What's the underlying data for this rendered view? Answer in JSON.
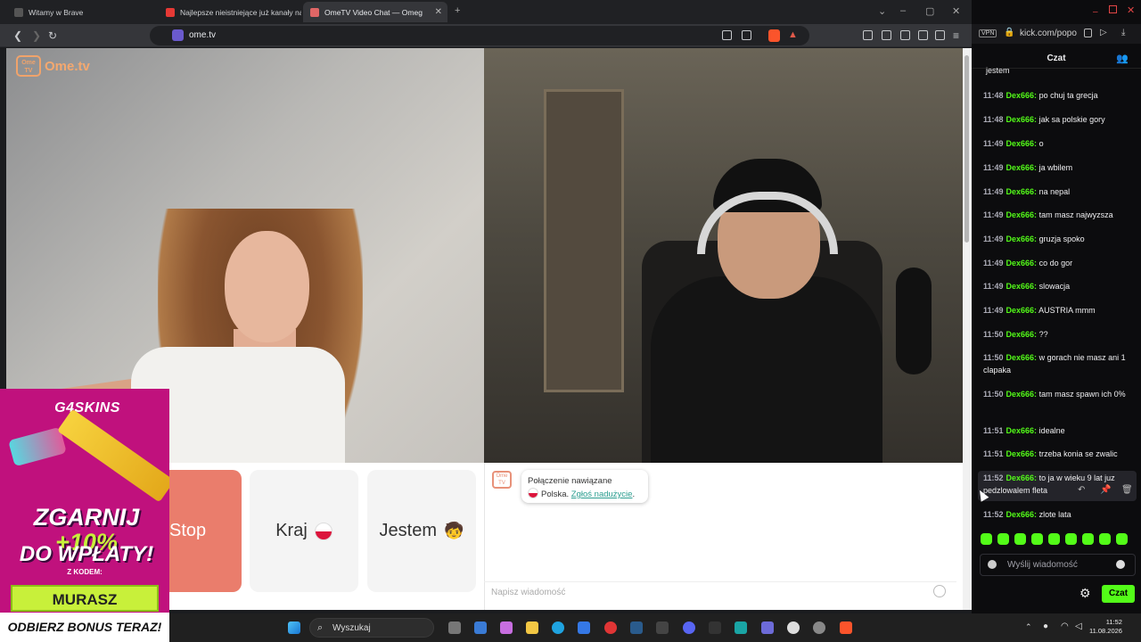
{
  "tabs": [
    {
      "title": "Witamy w Brave"
    },
    {
      "title": "Najlepsze nieistniejące już kanały na"
    },
    {
      "title": "OmeTV Video Chat — Omeg"
    }
  ],
  "address": {
    "url": "ome.tv"
  },
  "site": {
    "logo_small": "Ome TV",
    "logo_text": "Ome.tv"
  },
  "controls": {
    "stop_label": "Stop",
    "country_label": "Kraj",
    "gender_label": "Jestem",
    "gender_emoji": "🧒"
  },
  "chat": {
    "status_line": "Połączenie nawiązane",
    "country": "Polska.",
    "report_link": "Zgłoś nadużycie",
    "report_suffix": ".",
    "input_placeholder": "Napisz wiadomość",
    "icon_text": "Ome TV"
  },
  "ad": {
    "brand": "G4SKINS",
    "headline_1": "ZGARNIJ",
    "headline_bonus": "+10%",
    "headline_2": "DO WPŁATY!",
    "code_label": "Z KODEM:",
    "code": "MURASZ",
    "cta": "ODBIERZ BONUS TERAZ!"
  },
  "taskbar": {
    "search_label": "Wyszukaj",
    "time": "11:52",
    "date": "11.08.2026"
  },
  "kick": {
    "url": "kick.com/popo",
    "vpn": "VPN",
    "panel_title": "Czat",
    "send_placeholder": "Wyślij wiadomość",
    "send_button": "Czat",
    "messages": [
      {
        "time": "",
        "user": "",
        "text": "jestem"
      },
      {
        "time": "11:48",
        "user": "Dex666:",
        "text": "po chuj ta grecja"
      },
      {
        "time": "11:48",
        "user": "Dex666:",
        "text": "jak sa polskie gory"
      },
      {
        "time": "11:49",
        "user": "Dex666:",
        "text": "o"
      },
      {
        "time": "11:49",
        "user": "Dex666:",
        "text": "ja wbilem"
      },
      {
        "time": "11:49",
        "user": "Dex666:",
        "text": "na nepal"
      },
      {
        "time": "11:49",
        "user": "Dex666:",
        "text": "tam masz najwyzsza"
      },
      {
        "time": "11:49",
        "user": "Dex666:",
        "text": "gruzja spoko"
      },
      {
        "time": "11:49",
        "user": "Dex666:",
        "text": "co do gor"
      },
      {
        "time": "11:49",
        "user": "Dex666:",
        "text": "slowacja"
      },
      {
        "time": "11:49",
        "user": "Dex666:",
        "text": "AUSTRIA mmm"
      },
      {
        "time": "11:50",
        "user": "Dex666:",
        "text": "??"
      },
      {
        "time": "11:50",
        "user": "Dex666:",
        "text": "w gorach nie masz ani 1 clapaka"
      },
      {
        "time": "11:50",
        "user": "Dex666:",
        "text": "tam masz spawn ich 0%"
      },
      {
        "time": "11:51",
        "user": "Dex666:",
        "text": "idealne"
      },
      {
        "time": "11:51",
        "user": "Dex666:",
        "text": "trzeba konia se zwalic"
      },
      {
        "time": "11:52",
        "user": "Dex666:",
        "text": "to ja w wieku 9 lat juz pedzlowalem fleta"
      },
      {
        "time": "11:52",
        "user": "Dex666:",
        "text": "zlote lata"
      }
    ]
  }
}
